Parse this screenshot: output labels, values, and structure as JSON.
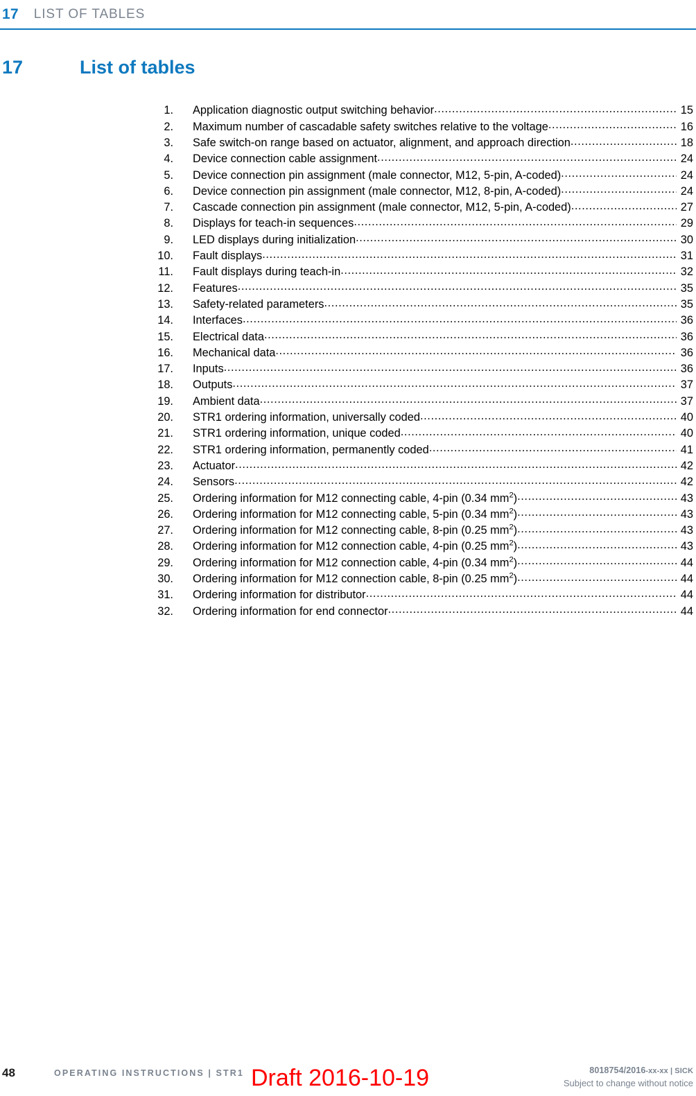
{
  "running_header": {
    "number": "17",
    "title": "LIST OF TABLES"
  },
  "chapter": {
    "number": "17",
    "title": "List of tables"
  },
  "colors": {
    "accent_blue": "#0e79bf",
    "header_gray": "#7b8490",
    "footer_gray": "#79838f",
    "draft_red": "#ff0000"
  },
  "toc": {
    "entries": [
      {
        "num": "1.",
        "label": "Application diagnostic output switching behavior",
        "page": "15"
      },
      {
        "num": "2.",
        "label": "Maximum number of cascadable safety switches relative to the voltage",
        "page": "16"
      },
      {
        "num": "3.",
        "label": "Safe switch-on range based on actuator, alignment, and approach direction",
        "page": "18"
      },
      {
        "num": "4.",
        "label": "Device connection cable assignment",
        "page": "24"
      },
      {
        "num": "5.",
        "label": "Device connection pin assignment (male connector, M12, 5-pin, A-coded)",
        "page": "24"
      },
      {
        "num": "6.",
        "label": "Device connection pin assignment (male connector, M12, 8-pin, A-coded)",
        "page": "24"
      },
      {
        "num": "7.",
        "label": "Cascade connection pin assignment (male connector, M12, 5-pin, A-coded)",
        "page": "27"
      },
      {
        "num": "8.",
        "label": "Displays for teach-in sequences",
        "page": "29"
      },
      {
        "num": "9.",
        "label": "LED displays during initialization",
        "page": "30"
      },
      {
        "num": "10.",
        "label": "Fault displays",
        "page": "31"
      },
      {
        "num": "11.",
        "label": "Fault displays during teach-in",
        "page": "32"
      },
      {
        "num": "12.",
        "label": "Features",
        "page": "35"
      },
      {
        "num": "13.",
        "label": "Safety-related parameters",
        "page": "35"
      },
      {
        "num": "14.",
        "label": "Interfaces",
        "page": "36"
      },
      {
        "num": "15.",
        "label": "Electrical data",
        "page": "36"
      },
      {
        "num": "16.",
        "label": "Mechanical data",
        "page": "36"
      },
      {
        "num": "17.",
        "label": "Inputs",
        "page": "36"
      },
      {
        "num": "18.",
        "label": "Outputs",
        "page": "37"
      },
      {
        "num": "19.",
        "label": "Ambient data",
        "page": "37"
      },
      {
        "num": "20.",
        "label": "STR1 ordering information, universally coded",
        "page": "40"
      },
      {
        "num": "21.",
        "label": "STR1 ordering information, unique coded",
        "page": "40"
      },
      {
        "num": "22.",
        "label": "STR1 ordering information, permanently coded",
        "page": "41"
      },
      {
        "num": "23.",
        "label": "Actuator",
        "page": "42"
      },
      {
        "num": "24.",
        "label": "Sensors",
        "page": "42"
      },
      {
        "num": "25.",
        "label": "Ordering information for M12 connecting cable, 4-pin (0.34 mm²)",
        "page": "43"
      },
      {
        "num": "26.",
        "label": "Ordering information for M12 connecting cable, 5-pin (0.34 mm²)",
        "page": "43"
      },
      {
        "num": "27.",
        "label": "Ordering information for M12 connecting cable, 8-pin (0.25 mm²)",
        "page": "43"
      },
      {
        "num": "28.",
        "label": "Ordering information for M12 connection cable, 4-pin (0.25 mm²)",
        "page": "43"
      },
      {
        "num": "29.",
        "label": "Ordering information for M12 connection cable, 4-pin (0.34 mm²)",
        "page": "44"
      },
      {
        "num": "30.",
        "label": "Ordering information for M12 connection cable, 8-pin (0.25 mm²)",
        "page": "44"
      },
      {
        "num": "31.",
        "label": "Ordering information for distributor",
        "page": "44"
      },
      {
        "num": "32.",
        "label": "Ordering information for end connector",
        "page": "44"
      }
    ]
  },
  "footer": {
    "page_number": "48",
    "document_title": "OPERATING INSTRUCTIONS | STR1",
    "doc_code": "8018754/2016-xx-xx | SICK",
    "notice": "Subject to change without notice"
  },
  "watermark": {
    "draft_text": "Draft 2016-10-19"
  }
}
